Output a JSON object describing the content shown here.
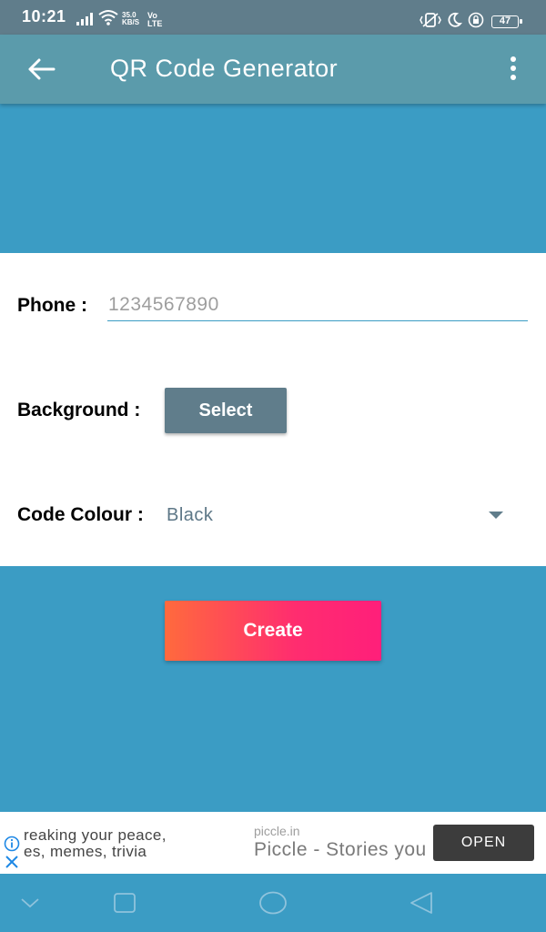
{
  "status_bar": {
    "time": "10:21",
    "net_speed": "35.0",
    "net_unit": "KB/S",
    "volte_top": "Vo",
    "volte_bottom": "LTE",
    "battery": "47"
  },
  "app_bar": {
    "title": "QR Code Generator",
    "back_icon": "arrow-back-icon",
    "menu_icon": "more-vert-icon"
  },
  "form": {
    "phone_label": "Phone :",
    "phone_placeholder": "1234567890",
    "phone_value": "",
    "background_label": "Background :",
    "select_button": "Select",
    "code_colour_label": "Code Colour :",
    "code_colour_value": "Black"
  },
  "create_button": "Create",
  "ad": {
    "text_line1": "reaking your peace,",
    "text_line2": "es, memes, trivia",
    "domain": "piccle.in",
    "title": "Piccle - Stories you love",
    "open_button": "OPEN"
  },
  "colors": {
    "background": "#3b9cc4",
    "app_bar": "#5b9bab",
    "status_bar": "#607d8b",
    "select_button": "#607d8b",
    "create_gradient_start": "#ff6a3d",
    "create_gradient_end": "#ff1f7a"
  }
}
